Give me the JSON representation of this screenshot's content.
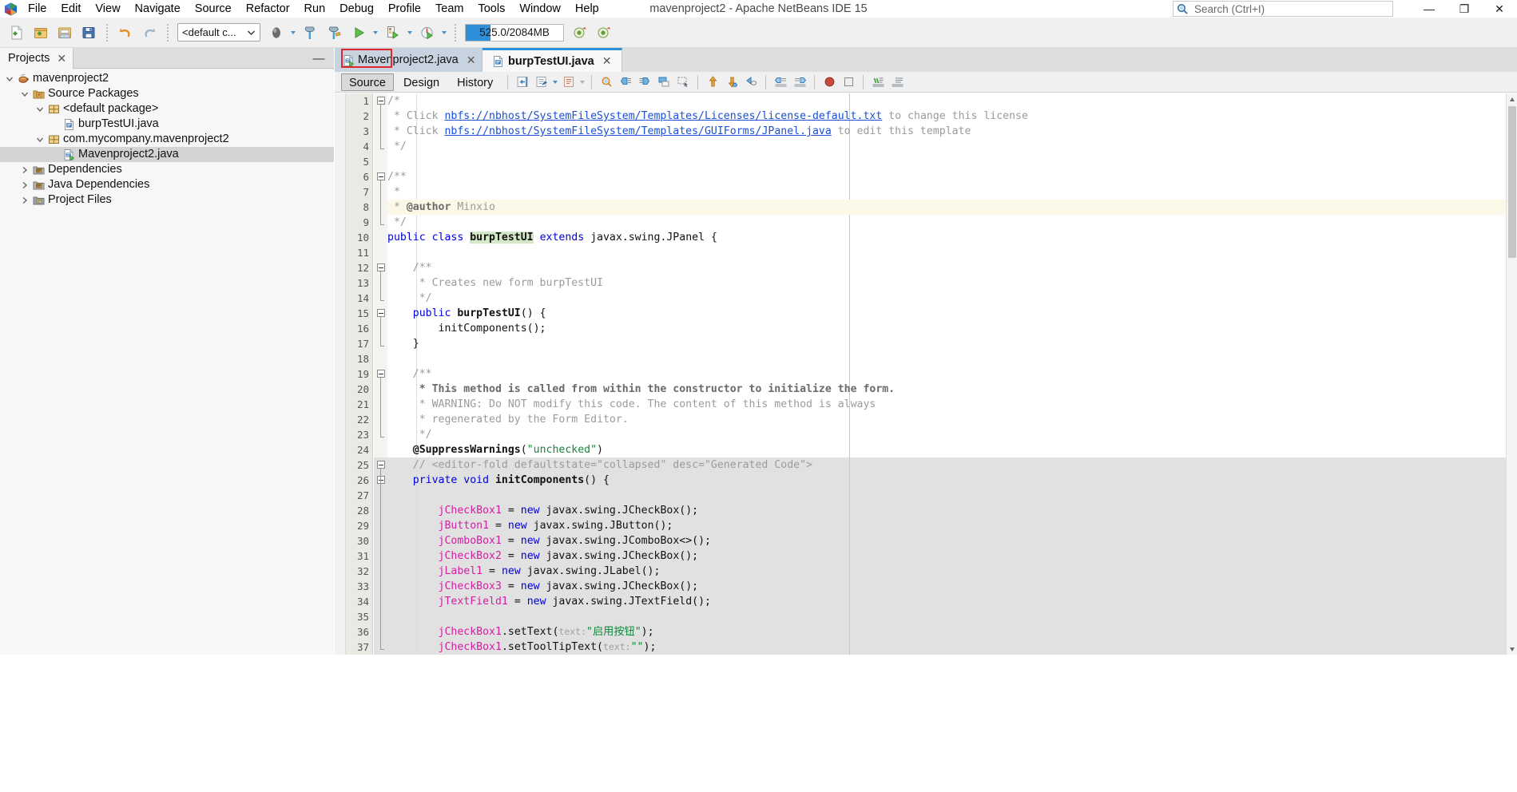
{
  "window": {
    "title": "mavenproject2 - Apache NetBeans IDE 15",
    "minimize_label": "—",
    "maximize_label": "❐",
    "close_label": "✕"
  },
  "menubar": {
    "logo_icon": "netbeans-logo-icon",
    "items": [
      {
        "label": "File",
        "name": "menu-file"
      },
      {
        "label": "Edit",
        "name": "menu-edit"
      },
      {
        "label": "View",
        "name": "menu-view"
      },
      {
        "label": "Navigate",
        "name": "menu-navigate"
      },
      {
        "label": "Source",
        "name": "menu-source"
      },
      {
        "label": "Refactor",
        "name": "menu-refactor"
      },
      {
        "label": "Run",
        "name": "menu-run"
      },
      {
        "label": "Debug",
        "name": "menu-debug"
      },
      {
        "label": "Profile",
        "name": "menu-profile"
      },
      {
        "label": "Team",
        "name": "menu-team"
      },
      {
        "label": "Tools",
        "name": "menu-tools"
      },
      {
        "label": "Window",
        "name": "menu-window"
      },
      {
        "label": "Help",
        "name": "menu-help"
      }
    ]
  },
  "search": {
    "placeholder": "Search (Ctrl+I)",
    "icon": "search-icon"
  },
  "toolbar": {
    "new_file_title": "New File",
    "new_project_title": "New Project",
    "open_project_title": "Open Project",
    "save_all_title": "Save All",
    "undo_title": "Undo",
    "redo_title": "Redo",
    "config_combo_value": "<default c...",
    "set_project_title": "Set Project Configuration",
    "build_title": "Build Project",
    "clean_build_title": "Clean and Build Project",
    "run_title": "Run Project",
    "debug_title": "Debug Project",
    "profile_title": "Profile Project",
    "memory": {
      "label": "525.0/2084MB",
      "used_mb": 525.0,
      "total_mb": 2084,
      "percent": 25,
      "fill_color": "#2f8fd8"
    }
  },
  "projects_panel": {
    "tab_label": "Projects",
    "tab_close": "✕",
    "minimize_label": "—",
    "tree": [
      {
        "label": "mavenproject2",
        "depth": 0,
        "icon": "maven-project-icon",
        "twist": "down",
        "selected": false
      },
      {
        "label": "Source Packages",
        "depth": 1,
        "icon": "source-packages-icon",
        "twist": "down",
        "selected": false
      },
      {
        "label": "<default package>",
        "depth": 2,
        "icon": "package-icon",
        "twist": "down",
        "selected": false
      },
      {
        "label": "burpTestUI.java",
        "depth": 3,
        "icon": "java-file-icon",
        "twist": "none",
        "selected": false
      },
      {
        "label": "com.mycompany.mavenproject2",
        "depth": 2,
        "icon": "package-icon",
        "twist": "down",
        "selected": false
      },
      {
        "label": "Mavenproject2.java",
        "depth": 3,
        "icon": "java-main-file-icon",
        "twist": "none",
        "selected": true
      },
      {
        "label": "Dependencies",
        "depth": 1,
        "icon": "dependencies-icon",
        "twist": "right",
        "selected": false
      },
      {
        "label": "Java Dependencies",
        "depth": 1,
        "icon": "dependencies-icon",
        "twist": "right",
        "selected": false
      },
      {
        "label": "Project Files",
        "depth": 1,
        "icon": "project-files-icon",
        "twist": "right",
        "selected": false
      }
    ]
  },
  "editor": {
    "tabs": [
      {
        "label": "Mavenproject2.java",
        "icon": "java-main-file-icon",
        "active": false,
        "close": "✕"
      },
      {
        "label": "burpTestUI.java",
        "icon": "java-file-icon",
        "active": true,
        "close": "✕"
      }
    ],
    "view_tabs": [
      {
        "label": "Source",
        "selected": true,
        "annotated": true
      },
      {
        "label": "Design",
        "selected": false,
        "annotated": false
      },
      {
        "label": "History",
        "selected": false,
        "annotated": false
      }
    ],
    "annotation_color": "#e0262c",
    "toolbar_buttons": [
      {
        "name": "last-edit-icon",
        "title": "Last Edit Position"
      },
      {
        "name": "toggle-rect-sel-icon",
        "title": "Toggle Rectangular Selection",
        "split": true
      },
      {
        "name": "format-icon",
        "title": "Format",
        "split": true
      },
      {
        "name": "find-selection-icon",
        "title": "Find Selection"
      },
      {
        "name": "previous-bookmark-icon",
        "title": "Previous Bookmark"
      },
      {
        "name": "next-bookmark-icon",
        "title": "Next Bookmark"
      },
      {
        "name": "toggle-bookmark-icon",
        "title": "Toggle Bookmark"
      },
      {
        "name": "select-in-editor-icon",
        "title": "Inspect Members"
      },
      {
        "name": "previous-error-icon",
        "title": "Previous Error"
      },
      {
        "name": "next-error-icon",
        "title": "Next Error"
      },
      {
        "name": "previous-occurrence-icon",
        "title": "Previous Occurrence"
      },
      {
        "name": "shift-left-icon",
        "title": "Shift Line Left"
      },
      {
        "name": "shift-right-icon",
        "title": "Shift Line Right"
      },
      {
        "name": "start-macro-icon",
        "title": "Start Macro Recording"
      },
      {
        "name": "stop-macro-icon",
        "title": "Stop Macro Recording"
      },
      {
        "name": "comment-icon",
        "title": "Comment"
      },
      {
        "name": "uncomment-icon",
        "title": "Uncomment"
      }
    ],
    "scrollbar": {
      "up": "▲",
      "down": "▼"
    },
    "code": {
      "first_line": 1,
      "highlight_line": 8,
      "generated_fold_start": 25,
      "lines": [
        {
          "n": 1,
          "fold": "start",
          "segs": [
            {
              "t": "/*",
              "c": "cm"
            }
          ]
        },
        {
          "n": 2,
          "segs": [
            {
              "t": " * Click ",
              "c": "cm"
            },
            {
              "t": "nbfs://nbhost/SystemFileSystem/Templates/Licenses/license-default.txt",
              "c": "lnk"
            },
            {
              "t": " to change this license",
              "c": "cm"
            }
          ]
        },
        {
          "n": 3,
          "segs": [
            {
              "t": " * Click ",
              "c": "cm"
            },
            {
              "t": "nbfs://nbhost/SystemFileSystem/Templates/GUIForms/JPanel.java",
              "c": "lnk"
            },
            {
              "t": " to edit this template",
              "c": "cm"
            }
          ]
        },
        {
          "n": 4,
          "fold": "end",
          "segs": [
            {
              "t": " */",
              "c": "cm"
            }
          ]
        },
        {
          "n": 5,
          "segs": []
        },
        {
          "n": 6,
          "fold": "start",
          "segs": [
            {
              "t": "/**",
              "c": "cm"
            }
          ]
        },
        {
          "n": 7,
          "segs": [
            {
              "t": " *",
              "c": "cm"
            }
          ]
        },
        {
          "n": 8,
          "highlight": "author",
          "segs": [
            {
              "t": " * ",
              "c": "cm"
            },
            {
              "t": "@author",
              "c": "cmb"
            },
            {
              "t": " Minxio",
              "c": "cm"
            }
          ]
        },
        {
          "n": 9,
          "fold": "end",
          "segs": [
            {
              "t": " */",
              "c": "cm"
            }
          ]
        },
        {
          "n": 10,
          "segs": [
            {
              "t": "public class ",
              "c": "kw"
            },
            {
              "t": "burpTestUI",
              "c": "ident-hl"
            },
            {
              "t": " extends",
              "c": "kw"
            },
            {
              "t": " javax.swing.JPanel {",
              "c": ""
            }
          ]
        },
        {
          "n": 11,
          "segs": []
        },
        {
          "n": 12,
          "fold": "start",
          "segs": [
            {
              "t": "    /**",
              "c": "cm"
            }
          ]
        },
        {
          "n": 13,
          "segs": [
            {
              "t": "     * Creates new form burpTestUI",
              "c": "cm"
            }
          ]
        },
        {
          "n": 14,
          "fold": "end",
          "segs": [
            {
              "t": "     */",
              "c": "cm"
            }
          ]
        },
        {
          "n": 15,
          "fold": "start",
          "segs": [
            {
              "t": "    public ",
              "c": "kw"
            },
            {
              "t": "burpTestUI",
              "c": "mth"
            },
            {
              "t": "() {",
              "c": ""
            }
          ]
        },
        {
          "n": 16,
          "segs": [
            {
              "t": "        initComponents();",
              "c": ""
            }
          ]
        },
        {
          "n": 17,
          "fold": "end",
          "segs": [
            {
              "t": "    }",
              "c": ""
            }
          ]
        },
        {
          "n": 18,
          "segs": []
        },
        {
          "n": 19,
          "fold": "start",
          "segs": [
            {
              "t": "    /**",
              "c": "cm"
            }
          ]
        },
        {
          "n": 20,
          "segs": [
            {
              "t": "     * This method is called from within the constructor to initialize the form.",
              "c": "cmb"
            }
          ]
        },
        {
          "n": 21,
          "segs": [
            {
              "t": "     * WARNING: Do NOT modify this code. The content of this method is always",
              "c": "cm"
            }
          ]
        },
        {
          "n": 22,
          "segs": [
            {
              "t": "     * regenerated by the Form Editor.",
              "c": "cm"
            }
          ]
        },
        {
          "n": 23,
          "fold": "end",
          "segs": [
            {
              "t": "     */",
              "c": "cm"
            }
          ]
        },
        {
          "n": 24,
          "segs": [
            {
              "t": "    @SuppressWarnings",
              "c": "bold"
            },
            {
              "t": "(",
              "c": ""
            },
            {
              "t": "\"unchecked\"",
              "c": "str"
            },
            {
              "t": ")",
              "c": ""
            }
          ]
        },
        {
          "n": 25,
          "fold": "start",
          "gen": true,
          "segs": [
            {
              "t": "    // <editor-fold defaultstate=\"collapsed\" desc=\"Generated Code\">",
              "c": "cm"
            }
          ]
        },
        {
          "n": 26,
          "fold": "start",
          "gen": true,
          "segs": [
            {
              "t": "    private void ",
              "c": "kw"
            },
            {
              "t": "initComponents",
              "c": "mth"
            },
            {
              "t": "() {",
              "c": ""
            }
          ]
        },
        {
          "n": 27,
          "gen": true,
          "segs": []
        },
        {
          "n": 28,
          "gen": true,
          "segs": [
            {
              "t": "        ",
              "c": ""
            },
            {
              "t": "jCheckBox1",
              "c": "fld"
            },
            {
              "t": " = ",
              "c": ""
            },
            {
              "t": "new",
              "c": "kw"
            },
            {
              "t": " javax.swing.JCheckBox();",
              "c": ""
            }
          ]
        },
        {
          "n": 29,
          "gen": true,
          "segs": [
            {
              "t": "        ",
              "c": ""
            },
            {
              "t": "jButton1",
              "c": "fld"
            },
            {
              "t": " = ",
              "c": ""
            },
            {
              "t": "new",
              "c": "kw"
            },
            {
              "t": " javax.swing.JButton();",
              "c": ""
            }
          ]
        },
        {
          "n": 30,
          "gen": true,
          "segs": [
            {
              "t": "        ",
              "c": ""
            },
            {
              "t": "jComboBox1",
              "c": "fld"
            },
            {
              "t": " = ",
              "c": ""
            },
            {
              "t": "new",
              "c": "kw"
            },
            {
              "t": " javax.swing.JComboBox<>();",
              "c": ""
            }
          ]
        },
        {
          "n": 31,
          "gen": true,
          "segs": [
            {
              "t": "        ",
              "c": ""
            },
            {
              "t": "jCheckBox2",
              "c": "fld"
            },
            {
              "t": " = ",
              "c": ""
            },
            {
              "t": "new",
              "c": "kw"
            },
            {
              "t": " javax.swing.JCheckBox();",
              "c": ""
            }
          ]
        },
        {
          "n": 32,
          "gen": true,
          "segs": [
            {
              "t": "        ",
              "c": ""
            },
            {
              "t": "jLabel1",
              "c": "fld"
            },
            {
              "t": " = ",
              "c": ""
            },
            {
              "t": "new",
              "c": "kw"
            },
            {
              "t": " javax.swing.JLabel();",
              "c": ""
            }
          ]
        },
        {
          "n": 33,
          "gen": true,
          "segs": [
            {
              "t": "        ",
              "c": ""
            },
            {
              "t": "jCheckBox3",
              "c": "fld"
            },
            {
              "t": " = ",
              "c": ""
            },
            {
              "t": "new",
              "c": "kw"
            },
            {
              "t": " javax.swing.JCheckBox();",
              "c": ""
            }
          ]
        },
        {
          "n": 34,
          "gen": true,
          "segs": [
            {
              "t": "        ",
              "c": ""
            },
            {
              "t": "jTextField1",
              "c": "fld"
            },
            {
              "t": " = ",
              "c": ""
            },
            {
              "t": "new",
              "c": "kw"
            },
            {
              "t": " javax.swing.JTextField();",
              "c": ""
            }
          ]
        },
        {
          "n": 35,
          "gen": true,
          "segs": []
        },
        {
          "n": 36,
          "gen": true,
          "segs": [
            {
              "t": "        ",
              "c": ""
            },
            {
              "t": "jCheckBox1",
              "c": "fld"
            },
            {
              "t": ".setText(",
              "c": ""
            },
            {
              "t": "text:",
              "c": "hint"
            },
            {
              "t": "\"启用按钮\"",
              "c": "str"
            },
            {
              "t": ");",
              "c": ""
            }
          ]
        },
        {
          "n": 37,
          "gen": true,
          "segs": [
            {
              "t": "        ",
              "c": ""
            },
            {
              "t": "jCheckBox1",
              "c": "fld"
            },
            {
              "t": ".setToolTipText(",
              "c": ""
            },
            {
              "t": "text:",
              "c": "hint"
            },
            {
              "t": "\"\"",
              "c": "str"
            },
            {
              "t": ");",
              "c": ""
            }
          ]
        }
      ]
    }
  }
}
